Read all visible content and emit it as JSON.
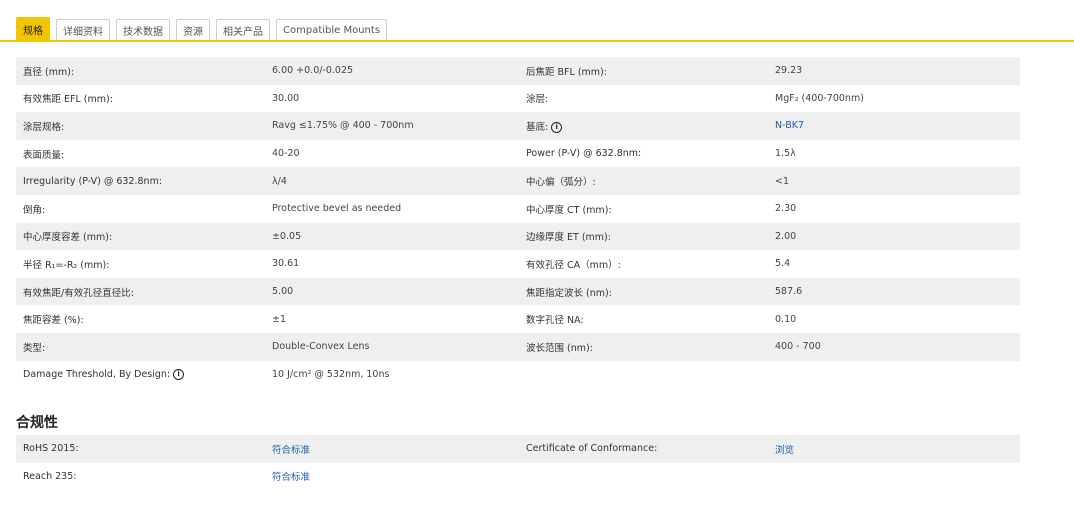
{
  "tabs": [
    "规格",
    "详细资料",
    "技术数据",
    "资源",
    "相关产品",
    "Compatible Mounts"
  ],
  "specs": [
    {
      "l1": "直径 (mm):",
      "v1": "6.00 +0.0/-0.025",
      "l2": "后焦距 BFL (mm):",
      "v2": "29.23"
    },
    {
      "l1": "有效焦距 EFL (mm):",
      "v1": "30.00",
      "l2": "涂层:",
      "v2": "MgF₂ (400-700nm)"
    },
    {
      "l1": "涂层规格:",
      "v1": "Ravg ≤1.75% @ 400 - 700nm",
      "l2": "基底:",
      "v2": "N-BK7"
    },
    {
      "l1": "表面质量:",
      "v1": "40-20",
      "l2": "Power (P-V) @ 632.8nm:",
      "v2": "1.5λ"
    },
    {
      "l1": "Irregularity (P-V) @ 632.8nm:",
      "v1": "λ/4",
      "l2": "中心偏（弧分）:",
      "v2": "<1"
    },
    {
      "l1": "倒角:",
      "v1": "Protective bevel as needed",
      "l2": "中心厚度 CT (mm):",
      "v2": "2.30"
    },
    {
      "l1": "中心厚度容差 (mm):",
      "v1": "±0.05",
      "l2": "边缘厚度 ET (mm):",
      "v2": "2.00"
    },
    {
      "l1": "半径 R₁=-R₂ (mm):",
      "v1": "30.61",
      "l2": "有效孔径 CA（mm）:",
      "v2": "5.4"
    },
    {
      "l1": "有效焦距/有效孔径直径比:",
      "v1": "5.00",
      "l2": "焦距指定波长 (nm):",
      "v2": "587.6"
    },
    {
      "l1": "焦距容差 (%):",
      "v1": "±1",
      "l2": "数字孔径 NA:",
      "v2": "0.10"
    },
    {
      "l1": "类型:",
      "v1": "Double-Convex Lens",
      "l2": "波长范围 (nm):",
      "v2": "400 - 700"
    },
    {
      "l1": "Damage Threshold, By Design:",
      "v1": "10 J/cm² @ 532nm, 10ns",
      "l2": "",
      "v2": ""
    }
  ],
  "compliance": {
    "title": "合规性",
    "rows": [
      {
        "l1": "RoHS 2015:",
        "v1": "符合标准",
        "l2": "Certificate of Conformance:",
        "v2": "浏览"
      },
      {
        "l1": "Reach 235:",
        "v1": "符合标准",
        "l2": "",
        "v2": ""
      }
    ]
  },
  "info_icon_glyph": "i"
}
